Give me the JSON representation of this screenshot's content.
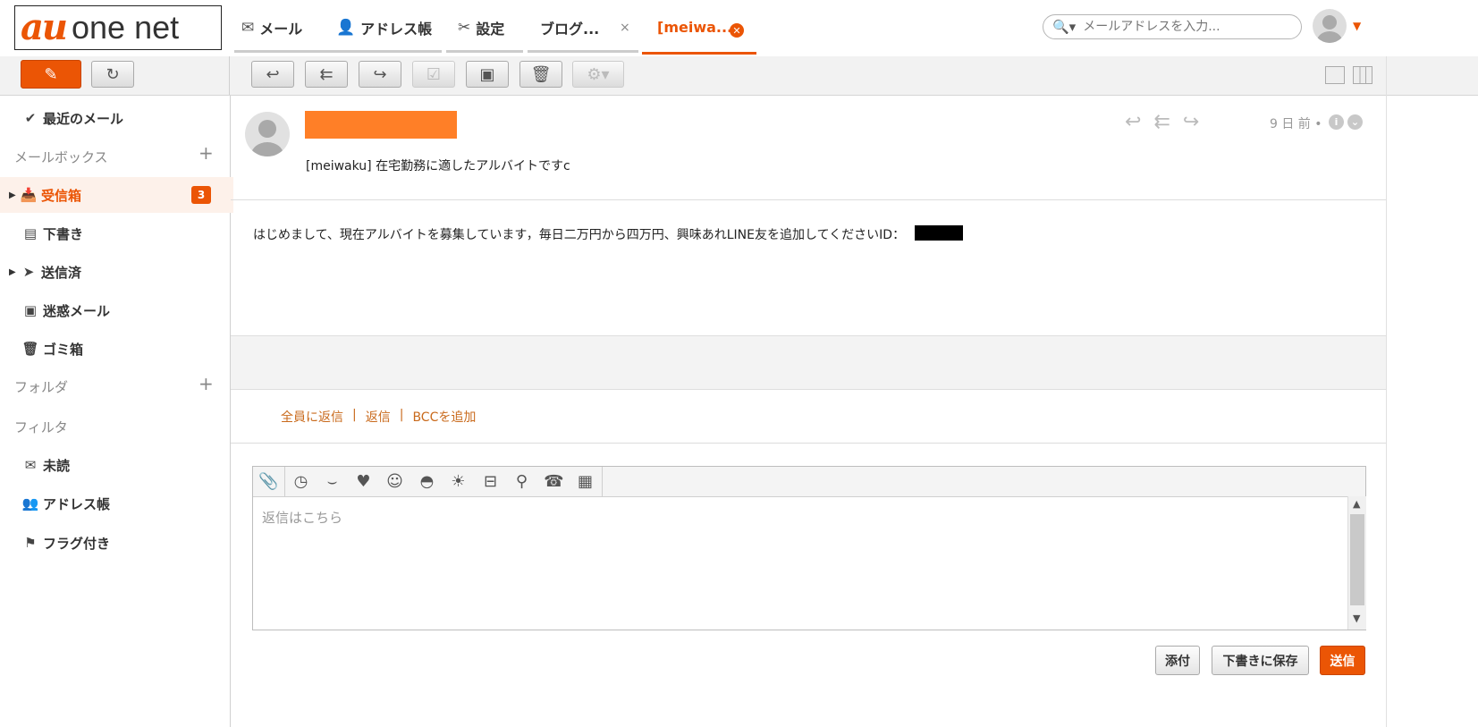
{
  "header": {
    "logo_au": "au",
    "logo_onenet": "one net",
    "tabs": [
      {
        "label": "メール"
      },
      {
        "label": "アドレス帳"
      },
      {
        "label": "設定"
      },
      {
        "label": "ブログ..."
      },
      {
        "label": "[meiwa..."
      }
    ],
    "tab_close_glyph": "×",
    "search_placeholder": "メールアドレスを入力..."
  },
  "sidebar": {
    "recent": "最近のメール",
    "mailbox_header": "メールボックス",
    "items": [
      {
        "label": "受信箱",
        "badge": "3"
      },
      {
        "label": "下書き"
      },
      {
        "label": "送信済"
      },
      {
        "label": "迷惑メール"
      },
      {
        "label": "ゴミ箱"
      }
    ],
    "folder_header": "フォルダ",
    "filter_header": "フィルタ",
    "filters": [
      {
        "label": "未読"
      },
      {
        "label": "アドレス帳"
      },
      {
        "label": "フラグ付き"
      }
    ],
    "plus": "+"
  },
  "message": {
    "subject": "[meiwaku] 在宅勤務に適したアルバイトですc",
    "date": "9 日 前",
    "date_dot": "•",
    "body": "はじめまして、現在アルバイトを募集しています，毎日二万円から四万円、興味あれLINE友を追加してくださいID："
  },
  "reply_links": {
    "reply_all": "全員に返信",
    "reply": "返信",
    "add_bcc": "BCCを追加",
    "sep": "|"
  },
  "editor": {
    "placeholder": "返信はこちら"
  },
  "buttons": {
    "attach": "添付",
    "save_draft": "下書きに保存",
    "send": "送信"
  },
  "colors": {
    "accent": "#eb5505",
    "redaction_orange": "#ff7f27",
    "link": "#c96a1c"
  }
}
